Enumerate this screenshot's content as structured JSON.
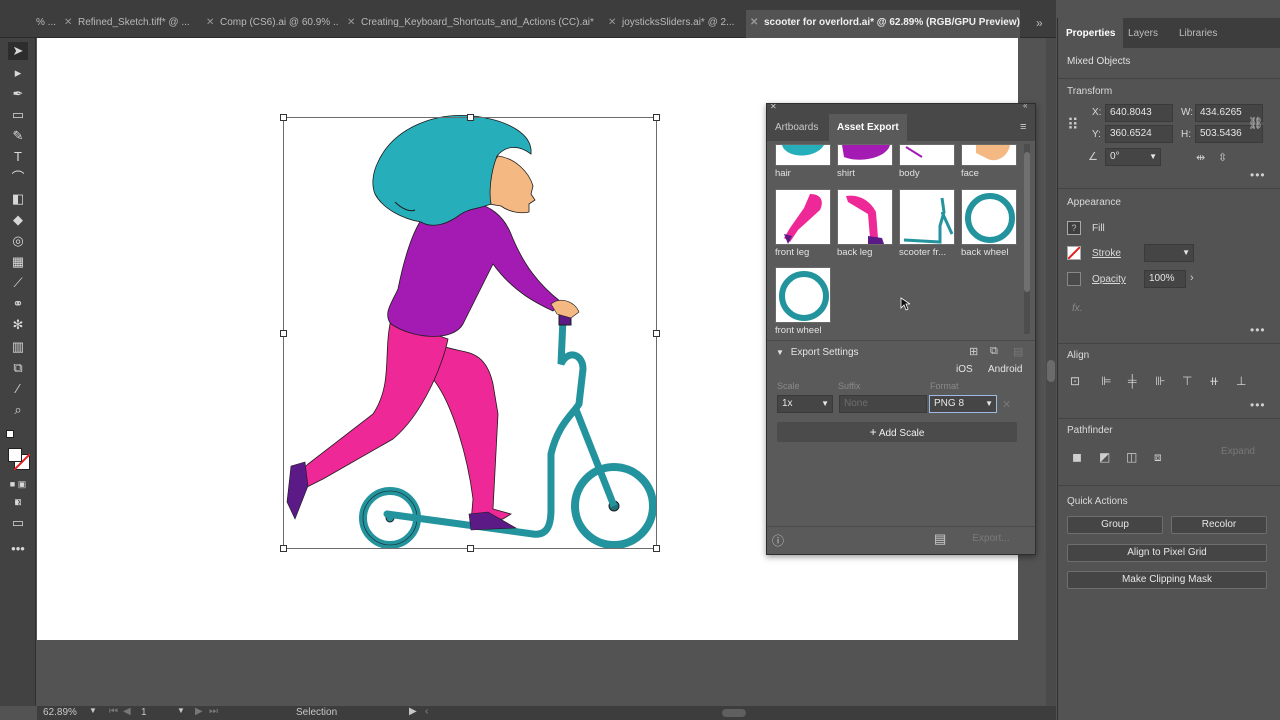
{
  "tabs": [
    {
      "label": "% ..."
    },
    {
      "label": "Refined_Sketch.tiff* @ ..."
    },
    {
      "label": "Comp (CS6).ai @ 60.9% ..."
    },
    {
      "label": "Creating_Keyboard_Shortcuts_and_Actions (CC).ai*"
    },
    {
      "label": "joysticksSliders.ai* @ 2..."
    },
    {
      "label": "scooter for overlord.ai* @ 62.89% (RGB/GPU Preview)"
    }
  ],
  "tabs_more": "»",
  "asset_panel": {
    "tabs": [
      "Artboards",
      "Asset Export"
    ],
    "assets": [
      {
        "label": "hair"
      },
      {
        "label": "shirt"
      },
      {
        "label": "body"
      },
      {
        "label": "face"
      },
      {
        "label": "front leg"
      },
      {
        "label": "back leg"
      },
      {
        "label": "scooter fr..."
      },
      {
        "label": "back wheel"
      },
      {
        "label": "front wheel"
      }
    ],
    "export_settings": "Export Settings",
    "ios": "iOS",
    "android": "Android",
    "scale_label": "Scale",
    "suffix_label": "Suffix",
    "format_label": "Format",
    "scale_value": "1x",
    "suffix_placeholder": "None",
    "format_value": "PNG 8",
    "add_scale": "Add Scale",
    "export_button": "Export..."
  },
  "props": {
    "tabs": [
      "Properties",
      "Layers",
      "Libraries"
    ],
    "selection": "Mixed Objects",
    "transform_title": "Transform",
    "x_label": "X:",
    "x_value": "640.8043",
    "y_label": "Y:",
    "y_value": "360.6524",
    "w_label": "W:",
    "w_value": "434.6265",
    "h_label": "H:",
    "h_value": "503.5436",
    "angle": "0°",
    "appearance_title": "Appearance",
    "fill": "Fill",
    "stroke": "Stroke",
    "opacity": "Opacity",
    "opacity_value": "100%",
    "fx": "fx.",
    "align_title": "Align",
    "pathfinder_title": "Pathfinder",
    "expand": "Expand",
    "quick_actions_title": "Quick Actions",
    "group": "Group",
    "recolor": "Recolor",
    "align_pixel": "Align to Pixel Grid",
    "clipping_mask": "Make Clipping Mask"
  },
  "status": {
    "zoom": "62.89%",
    "artboard": "1",
    "tool": "Selection"
  },
  "colors": {
    "hair": "#27aebb",
    "shirt": "#a41bb3",
    "pants": "#ee2896",
    "scooter": "#23939e",
    "shoe": "#5b1a86",
    "skin": "#f4b882"
  }
}
